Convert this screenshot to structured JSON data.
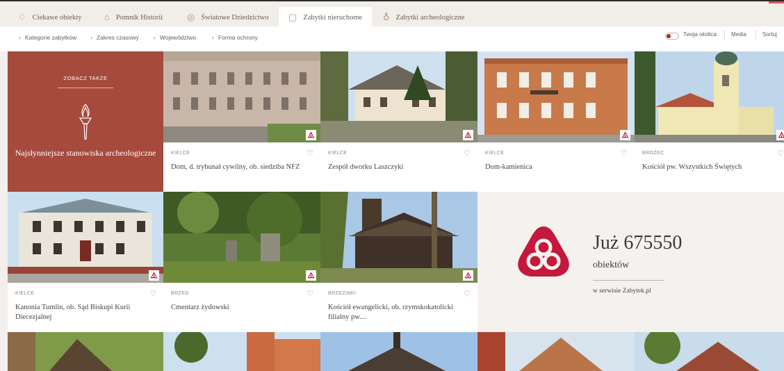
{
  "tabs": [
    {
      "label": "Ciekawe obiekty",
      "icon": "gem-icon"
    },
    {
      "label": "Pomnik Historii",
      "icon": "monument-icon"
    },
    {
      "label": "Światowe Dziedzictwo",
      "icon": "heritage-icon"
    },
    {
      "label": "Zabytki nieruchome",
      "icon": "building-icon"
    },
    {
      "label": "Zabytki archeologiczne",
      "icon": "torch-icon"
    }
  ],
  "filters": [
    {
      "label": "Kategorie zabytków"
    },
    {
      "label": "Zakres czasowy"
    },
    {
      "label": "Województwo"
    },
    {
      "label": "Forma ochrony"
    }
  ],
  "right_controls": {
    "toggle_label": "Twoja okolica",
    "media_label": "Media",
    "sort_label": "Sortuj"
  },
  "promo": {
    "kicker": "ZOBACZ TAKŻE",
    "title": "Najsłynniejsze stanowiska archeologiczne"
  },
  "cards": [
    {
      "city": "KIELCE",
      "name": "Dom, d. trybunał cywilny, ob. siedziba NFZ"
    },
    {
      "city": "KIELCE",
      "name": "Zespół dworku Laszczyki"
    },
    {
      "city": "KIELCE",
      "name": "Dom-kamienica"
    },
    {
      "city": "BROŻEC",
      "name": "Kościół pw. Wszystkich Świętych"
    },
    {
      "city": "KIELCE",
      "name": "Kanonia Tumlin, ob. Sąd Biskupi Kurii Diecezjalnej"
    },
    {
      "city": "BRZEG",
      "name": "Cmentarz żydowski"
    },
    {
      "city": "BRZEZINKI",
      "name": "Kościół ewangelicki, ob. rzymskokatolicki filialny pw...."
    }
  ],
  "stats": {
    "number": "Już 675550",
    "unit": "obiektów",
    "subtitle": "w serwisie Zabytek.pl"
  },
  "colors": {
    "brand_red": "#c4183c",
    "promo_bg": "#a54a3c",
    "topbar_bg": "#f1ede9"
  }
}
